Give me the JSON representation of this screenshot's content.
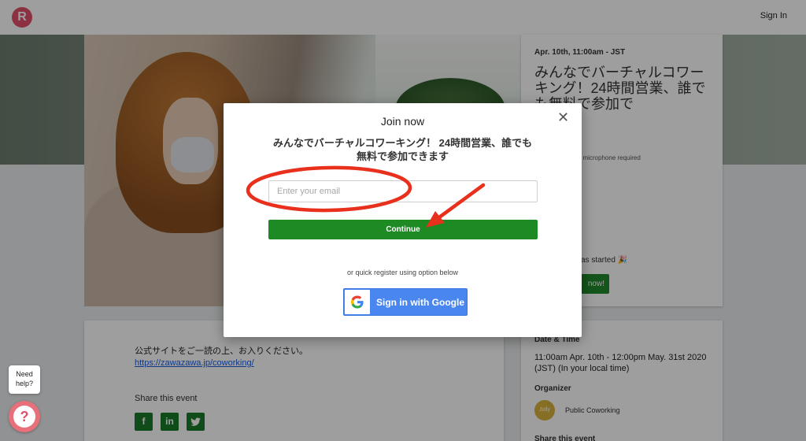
{
  "header": {
    "signin_label": "Sign In"
  },
  "event": {
    "date": "Apr. 10th, 11:00am - JST",
    "title": "みんなでバーチャルコワーキング！24時間営業、誰でも無料で参加で",
    "mic_text": ", microphone required",
    "started_text": "as started 🎉",
    "join_label": "now!",
    "description": "公式サイトをご一読の上、お入りください。",
    "link": "https://zawazawa.jp/coworking/",
    "share_label": "Share this event",
    "datetime_label": "Date & Time",
    "datetime_value": "11:00am Apr. 10th - 12:00pm May. 31st 2020 (JST) (In your local time)",
    "organizer_label": "Organizer",
    "organizer_name": "Public Coworking",
    "share_label_side": "Share this event"
  },
  "help": {
    "bubble_text": "Need help?"
  },
  "modal": {
    "title": "Join now",
    "heading": "みんなでバーチャルコワーキング！ 24時間営業、誰でも無料で参加できます",
    "email_placeholder": "Enter your email",
    "continue_label": "Continue",
    "quick_text": "or quick register using option below",
    "google_label": "Sign in with Google"
  },
  "icons": {
    "logo": "remo-logo-icon",
    "close": "close-icon",
    "help": "help-icon",
    "google": "google-icon",
    "social": [
      "facebook-icon",
      "linkedin-icon",
      "twitter-icon"
    ]
  },
  "colors": {
    "primary_green": "#1d8a23",
    "google_blue": "#4a86f0",
    "annotation_red": "#e8301c",
    "brand_pink": "#e0506a"
  }
}
